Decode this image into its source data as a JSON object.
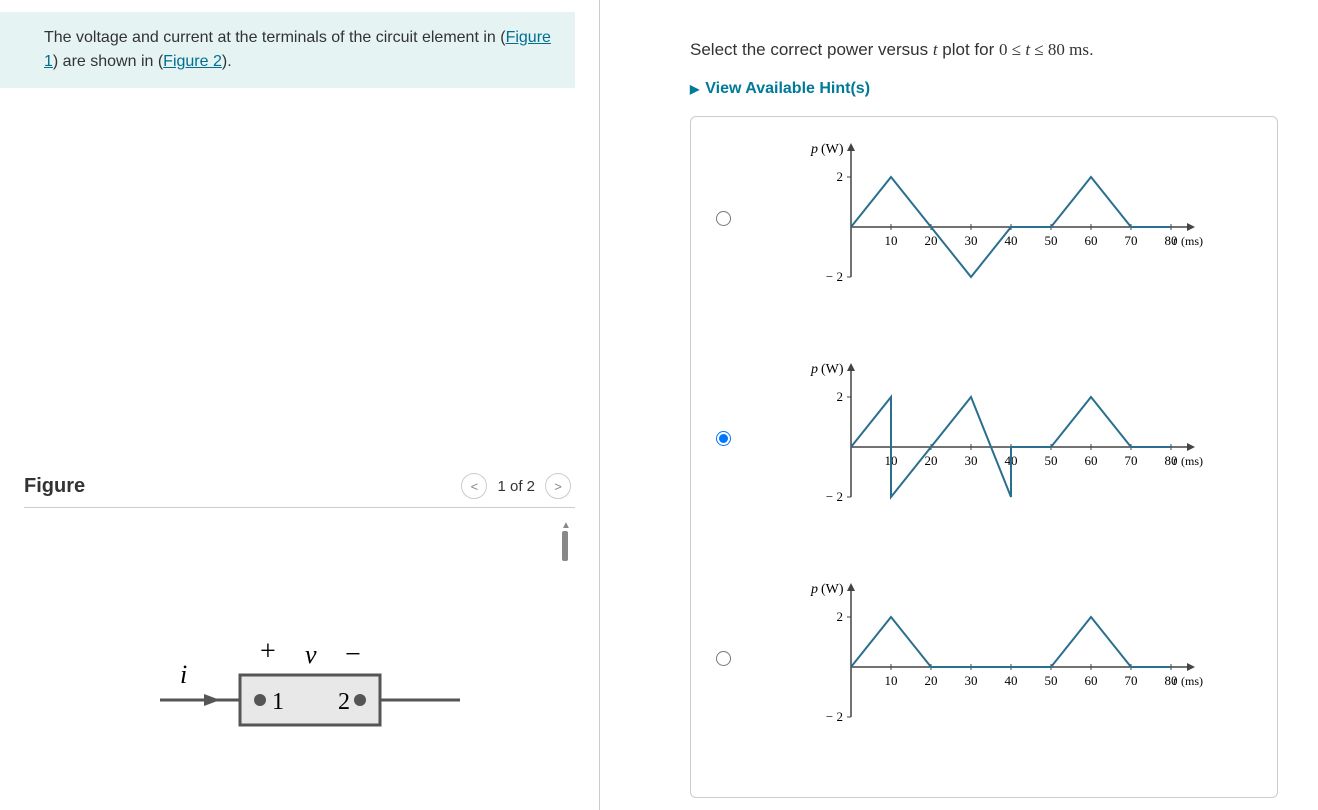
{
  "intro": {
    "text_before": "The voltage and current at the terminals of the circuit element in (",
    "link1": "Figure 1",
    "text_mid": ") are shown in (",
    "link2": "Figure 2",
    "text_after": ")."
  },
  "figure": {
    "title": "Figure",
    "pager": "1 of 2",
    "prev": "<",
    "next": ">",
    "diagram": {
      "i_label": "i",
      "plus": "+",
      "v_label": "v",
      "minus": "−",
      "node1": "1",
      "node2": "2"
    }
  },
  "question": {
    "prefix": "Select the correct power versus ",
    "var_t": "t",
    "mid": " plot for ",
    "range": "0 ≤ t ≤ 80 ms",
    "suffix": "."
  },
  "hints_label": "View Available Hint(s)",
  "chart_data": [
    {
      "type": "line",
      "ylabel": "p (W)",
      "xlabel": "t (ms)",
      "ylim": [
        -3,
        3
      ],
      "xlim": [
        0,
        85
      ],
      "yticks": [
        -2,
        2
      ],
      "xticks": [
        10,
        20,
        30,
        40,
        50,
        60,
        70,
        80
      ],
      "series": [
        {
          "name": "p",
          "x": [
            0,
            10,
            20,
            30,
            40,
            50,
            60,
            70,
            80
          ],
          "y": [
            0,
            2,
            0,
            -2,
            0,
            0,
            2,
            0,
            0
          ]
        }
      ]
    },
    {
      "type": "line",
      "ylabel": "p (W)",
      "xlabel": "t (ms)",
      "ylim": [
        -3,
        3
      ],
      "xlim": [
        0,
        85
      ],
      "yticks": [
        -2,
        2
      ],
      "xticks": [
        10,
        20,
        30,
        40,
        50,
        60,
        70,
        80
      ],
      "series": [
        {
          "name": "p",
          "x": [
            0,
            10,
            10,
            20,
            30,
            40,
            40,
            50,
            60,
            70,
            80
          ],
          "y": [
            0,
            2,
            -2,
            0,
            2,
            -2,
            0,
            0,
            2,
            0,
            0
          ]
        }
      ]
    },
    {
      "type": "line",
      "ylabel": "p (W)",
      "xlabel": "t (ms)",
      "ylim": [
        -3,
        3
      ],
      "xlim": [
        0,
        85
      ],
      "yticks": [
        -2,
        2
      ],
      "xticks": [
        10,
        20,
        30,
        40,
        50,
        60,
        70,
        80
      ],
      "series": [
        {
          "name": "p",
          "x": [
            0,
            10,
            20,
            30,
            40,
            50,
            60,
            70,
            80
          ],
          "y": [
            0,
            2,
            0,
            0,
            0,
            0,
            2,
            0,
            0
          ]
        }
      ]
    }
  ],
  "selected_option": 1
}
